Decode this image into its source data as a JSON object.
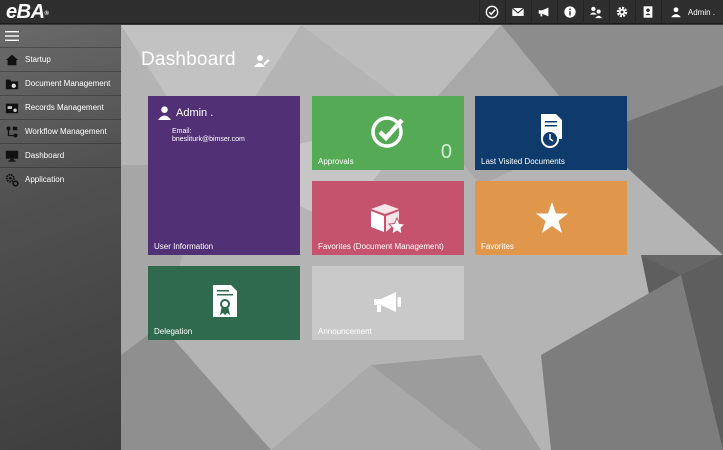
{
  "app": {
    "logo": "eBA",
    "logo_mark": "®"
  },
  "topbar": {
    "icons": [
      "check-circle-icon",
      "mail-icon",
      "megaphone-icon",
      "info-icon",
      "users-icon",
      "gear-icon",
      "document-user-icon"
    ],
    "user_label": "Admin ."
  },
  "sidebar": {
    "items": [
      {
        "label": "Startup",
        "icon": "home-icon"
      },
      {
        "label": "Document Management",
        "icon": "folder-gear-icon"
      },
      {
        "label": "Records Management",
        "icon": "records-icon"
      },
      {
        "label": "Workflow Management",
        "icon": "workflow-icon"
      },
      {
        "label": "Dashboard",
        "icon": "monitor-icon"
      },
      {
        "label": "Application",
        "icon": "application-gear-icon"
      }
    ]
  },
  "main": {
    "title": "Dashboard",
    "tiles": {
      "user": {
        "name": "Admin .",
        "email_label": "Email:",
        "email": "bnesliturk@bimser.com",
        "label": "User Information"
      },
      "approvals": {
        "label": "Approvals",
        "count": "0"
      },
      "last_visited": {
        "label": "Last Visited Documents"
      },
      "fav_doc": {
        "label": "Favorites (Document Management)"
      },
      "favorites": {
        "label": "Favorites"
      },
      "delegation": {
        "label": "Delegation"
      },
      "announcement": {
        "label": "Announcement"
      }
    }
  },
  "colors": {
    "user_tile": "#523076",
    "approvals_tile": "#55ab55",
    "last_visited_tile": "#0e3b6b",
    "fav_doc_tile": "#c6536e",
    "favorites_tile": "#e0974b",
    "delegation_tile": "#2f6a4e",
    "announcement_tile": "#c9c9c9"
  }
}
